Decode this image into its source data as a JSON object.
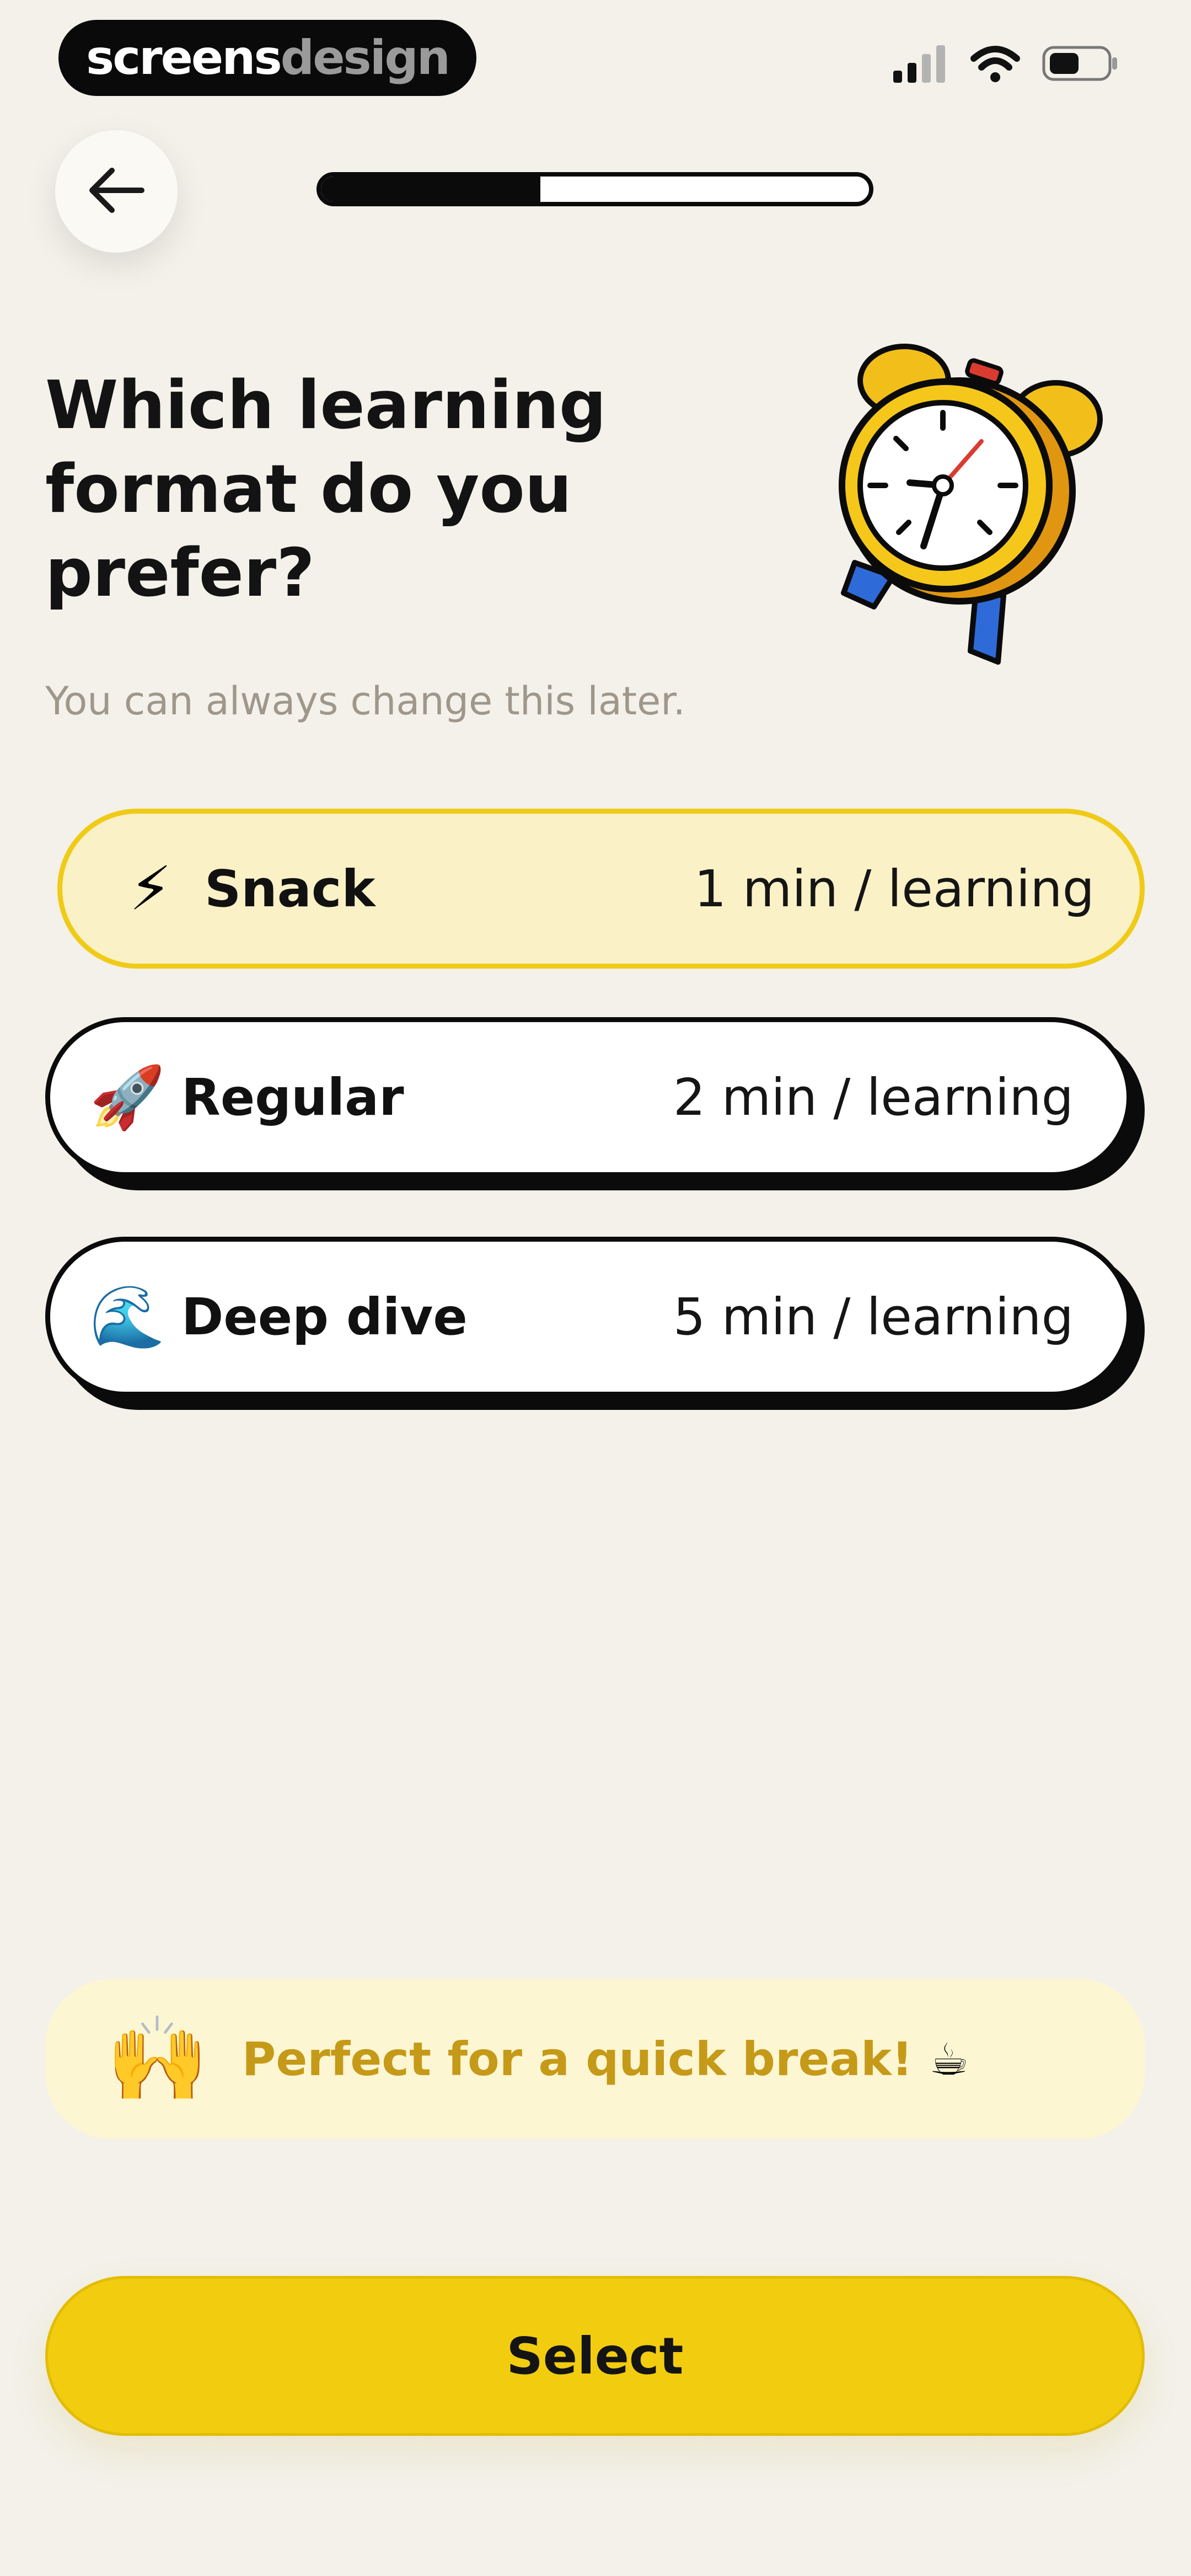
{
  "status_bar": {
    "brand_part1": "screens",
    "brand_part2": "design",
    "signal_icon": "cellular-signal-icon",
    "wifi_icon": "wifi-icon",
    "battery_icon": "battery-icon"
  },
  "nav": {
    "back_icon": "arrow-left-icon",
    "progress_fraction": 0.4
  },
  "question": {
    "title": "Which learning format do you prefer?",
    "subtitle": "You can always change this later.",
    "illustration": "alarm-clock-icon"
  },
  "options": [
    {
      "emoji": "⚡",
      "label": "Snack",
      "duration": "1 min / learning",
      "selected": true
    },
    {
      "emoji": "🚀",
      "label": "Regular",
      "duration": "2 min / learning",
      "selected": false
    },
    {
      "emoji": "🌊",
      "label": "Deep dive",
      "duration": "5 min / learning",
      "selected": false
    }
  ],
  "feedback": {
    "emoji": "🙌",
    "text": "Perfect for a quick break!",
    "trailing_emoji": "☕"
  },
  "cta": {
    "label": "Select"
  },
  "colors": {
    "background": "#f3f1e9",
    "accent_yellow": "#f2cc0f",
    "selected_fill": "#fbf1c6",
    "feedback_text": "#c59a18"
  }
}
